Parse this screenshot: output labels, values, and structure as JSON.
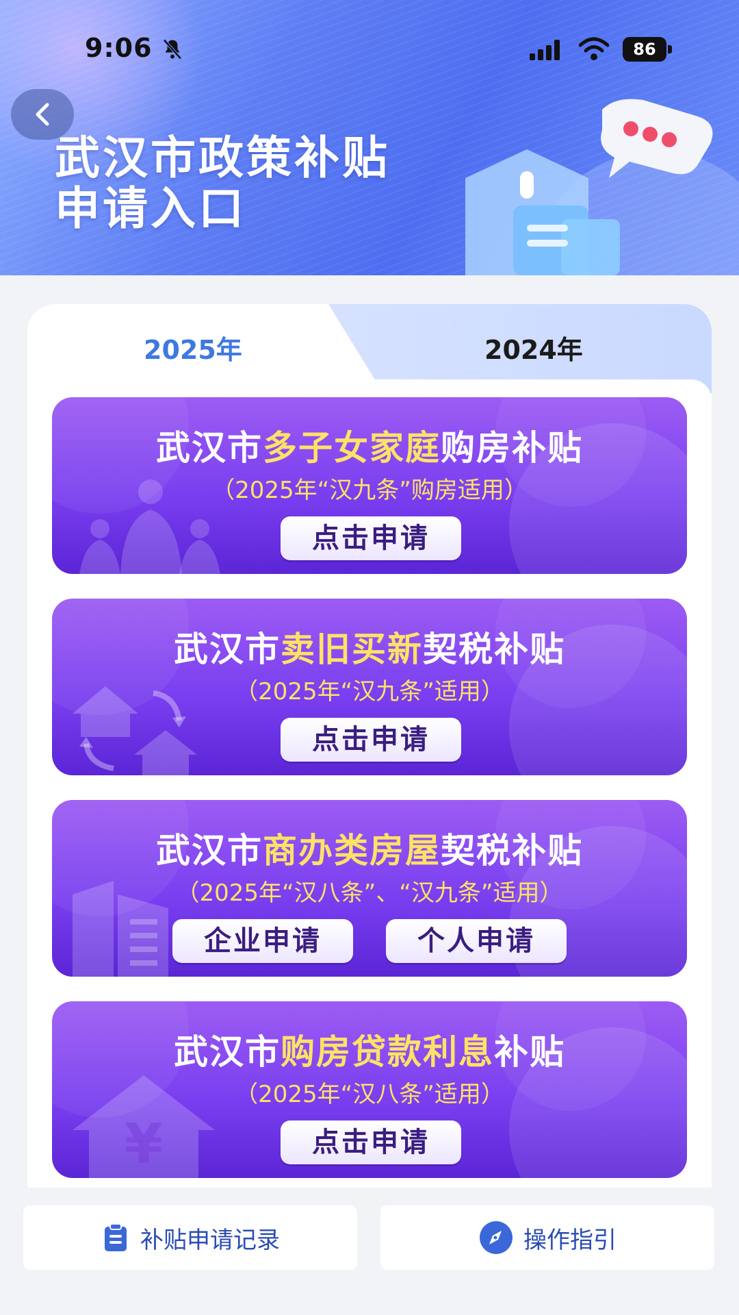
{
  "status_bar": {
    "time": "9:06",
    "battery": "86"
  },
  "header": {
    "title_line1": "武汉市政策补贴",
    "title_line2": "申请入口"
  },
  "tabs": [
    {
      "label": "2025年",
      "active": true
    },
    {
      "label": "2024年",
      "active": false
    }
  ],
  "banners": [
    {
      "title_prefix": "武汉市",
      "title_highlight": "多子女家庭",
      "title_suffix": "购房补贴",
      "subtitle": "（2025年“汉九条”购房适用）",
      "buttons": [
        "点击申请"
      ]
    },
    {
      "title_prefix": "武汉市",
      "title_highlight": "卖旧买新",
      "title_suffix": "契税补贴",
      "subtitle": "（2025年“汉九条”适用）",
      "buttons": [
        "点击申请"
      ]
    },
    {
      "title_prefix": "武汉市",
      "title_highlight": "商办类房屋",
      "title_suffix": "契税补贴",
      "subtitle": "（2025年“汉八条”、“汉九条”适用）",
      "buttons": [
        "企业申请",
        "个人申请"
      ]
    },
    {
      "title_prefix": "武汉市",
      "title_highlight": "购房贷款利息",
      "title_suffix": "补贴",
      "subtitle": "（2025年“汉八条”适用）",
      "buttons": [
        "点击申请"
      ]
    }
  ],
  "bottom_bar": {
    "records_label": "补贴申请记录",
    "guide_label": "操作指引"
  },
  "colors": {
    "accent_blue": "#3f78e0",
    "highlight_yellow": "#ffe266",
    "banner_purple": "#7a3ff0"
  },
  "icons": {
    "back": "chevron-left-icon",
    "records": "clipboard-icon",
    "guide": "compass-icon"
  }
}
